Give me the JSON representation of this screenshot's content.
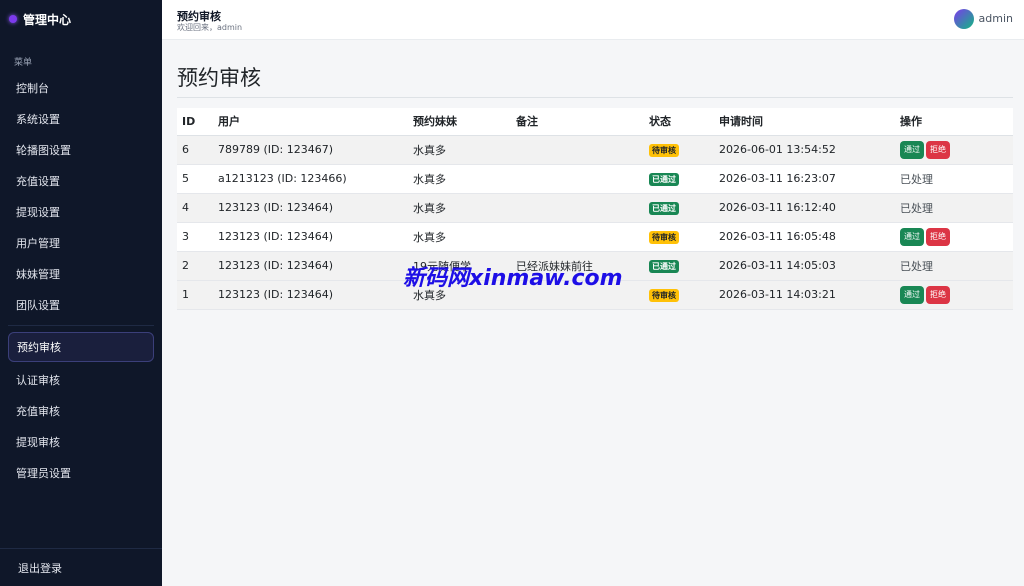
{
  "sidebar": {
    "brand": "管理中心",
    "menu_heading": "菜单",
    "items": [
      {
        "label": "控制台"
      },
      {
        "label": "系统设置"
      },
      {
        "label": "轮播图设置"
      },
      {
        "label": "充值设置"
      },
      {
        "label": "提现设置"
      },
      {
        "label": "用户管理"
      },
      {
        "label": "妹妹管理"
      },
      {
        "label": "团队设置"
      }
    ],
    "items2": [
      {
        "label": "预约审核"
      },
      {
        "label": "认证审核"
      },
      {
        "label": "充值审核"
      },
      {
        "label": "提现审核"
      },
      {
        "label": "管理员设置"
      }
    ],
    "logout": "退出登录"
  },
  "topbar": {
    "title": "预约审核",
    "subtitle": "欢迎回来，admin",
    "username": "admin"
  },
  "main": {
    "title": "预约审核",
    "columns": [
      "ID",
      "用户",
      "预约妹妹",
      "备注",
      "状态",
      "申请时间",
      "操作"
    ],
    "rows": [
      {
        "id": "6",
        "user": "789789 (ID: 123467)",
        "girl": "水真多",
        "note": "",
        "status": "待审核",
        "status_type": "pending",
        "time": "2026-06-01 13:54:52",
        "actions": [
          "通过",
          "拒绝"
        ],
        "done": ""
      },
      {
        "id": "5",
        "user": "a1213123 (ID: 123466)",
        "girl": "水真多",
        "note": "",
        "status": "已通过",
        "status_type": "approved",
        "time": "2026-03-11 16:23:07",
        "actions": [],
        "done": "已处理"
      },
      {
        "id": "4",
        "user": "123123 (ID: 123464)",
        "girl": "水真多",
        "note": "",
        "status": "已通过",
        "status_type": "approved",
        "time": "2026-03-11 16:12:40",
        "actions": [],
        "done": "已处理"
      },
      {
        "id": "3",
        "user": "123123 (ID: 123464)",
        "girl": "水真多",
        "note": "",
        "status": "待审核",
        "status_type": "pending",
        "time": "2026-03-11 16:05:48",
        "actions": [
          "通过",
          "拒绝"
        ],
        "done": ""
      },
      {
        "id": "2",
        "user": "123123 (ID: 123464)",
        "girl": "19元随便学",
        "note": "已经派妹妹前往",
        "status": "已通过",
        "status_type": "approved",
        "time": "2026-03-11 14:05:03",
        "actions": [],
        "done": "已处理"
      },
      {
        "id": "1",
        "user": "123123 (ID: 123464)",
        "girl": "水真多",
        "note": "",
        "status": "待审核",
        "status_type": "pending",
        "time": "2026-03-11 14:03:21",
        "actions": [
          "通过",
          "拒绝"
        ],
        "done": ""
      }
    ]
  },
  "watermark": "新码网xinmaw.com",
  "colors": {
    "sidebar_bg": "#0f1729",
    "approve": "#198754",
    "reject": "#dc3545",
    "pending": "#ffc107"
  }
}
